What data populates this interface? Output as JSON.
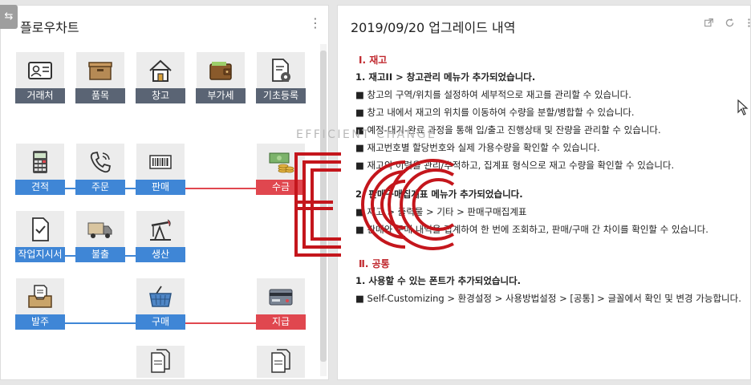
{
  "left_panel": {
    "title": "플로우차트",
    "toggle_glyph": "⇆",
    "menu_glyph": "⋮",
    "items": {
      "client": "거래처",
      "product": "품목",
      "warehouse": "창고",
      "vat": "부가세",
      "basic_reg": "기초등록",
      "estimate": "견적",
      "order": "주문",
      "sales": "판매",
      "receipt": "수금",
      "work_order": "작업지시서",
      "shipment": "불출",
      "production": "생산",
      "place_order": "발주",
      "purchase": "구매",
      "payment": "지급"
    },
    "colors": {
      "blue": "#3f86d6",
      "red": "#e0474f",
      "dark": "#5a6474"
    }
  },
  "right_panel": {
    "title": "2019/09/20 업그레이드 내역",
    "icons": [
      "external-link-icon",
      "refresh-icon",
      "more-icon"
    ],
    "sections": [
      {
        "heading": "Ⅰ. 재고",
        "sub": "1. 재고II > 창고관리 메뉴가 추가되었습니다.",
        "bullets": [
          "■ 창고의 구역/위치를 설정하여 세부적으로 재고를 관리할 수 있습니다.",
          "■ 창고 내에서 재고의 위치를 이동하여 수량을 분할/병합할 수 있습니다.",
          "■ 예정-대기-완료 과정을 통해 입/출고 진행상태 및 잔량을 관리할 수 있습니다.",
          "■ 재고번호별 할당번호와 실제 가용수량을 확인할 수 있습니다.",
          "■ 재고의 이력을 관리/추적하고, 집계표 형식으로 재고 수량을 확인할 수 있습니다."
        ],
        "sub2": "2. 판매구매집계표 메뉴가 추가되었습니다.",
        "bullets2": [
          "■ 재고 > 출력물 > 기타 > 판매구매집계표",
          "■ 판매와 구매 내역을 집계하여 한 번에 조회하고, 판매/구매 간 차이를 확인할 수 있습니다."
        ]
      },
      {
        "heading": "Ⅱ. 공통",
        "sub": "1. 사용할 수 있는 폰트가 추가되었습니다.",
        "bullets": [
          "■ Self-Customizing > 환경설정 > 사용방법설정 > [공통] > 글꼴에서 확인 및 변경 가능합니다."
        ]
      }
    ]
  },
  "watermark": {
    "text": "EFFICIENT CHANGE",
    "color": "#c4161c"
  }
}
